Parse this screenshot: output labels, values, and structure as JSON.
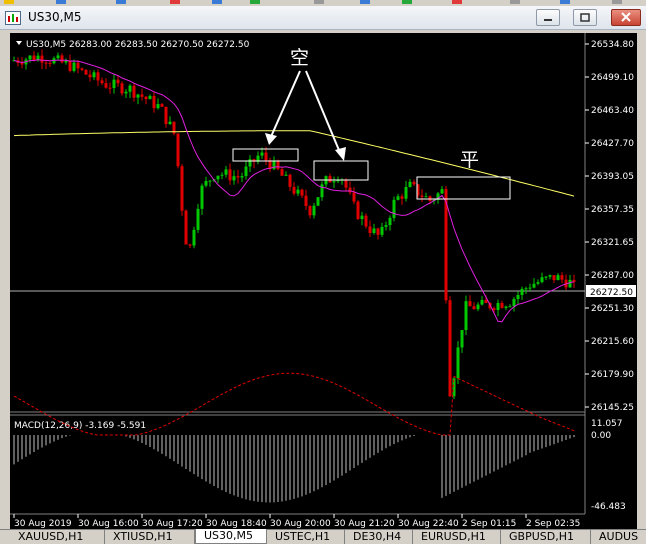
{
  "window": {
    "title": "US30,M5"
  },
  "chart": {
    "info_line": "US30,M5  26283.00 26283.50 26270.50 26272.50",
    "macd_label": "MACD(12,26,9) -3.169 -5.591",
    "price_levels": [
      "26534.80",
      "26499.10",
      "26463.40",
      "26427.70",
      "26393.05",
      "26357.35",
      "26321.65",
      "26287.00",
      "26251.30",
      "26215.60",
      "26179.90",
      "26145.25"
    ],
    "current_price": "26272.50",
    "macd_levels": [
      "11.057",
      "0.00",
      "-46.483"
    ],
    "time_labels": [
      "30 Aug 2019",
      "30 Aug 16:00",
      "30 Aug 17:20",
      "30 Aug 18:40",
      "30 Aug 20:00",
      "30 Aug 21:20",
      "30 Aug 22:40",
      "2 Sep 01:15",
      "2 Sep 02:35"
    ],
    "annotations": {
      "short_label": "空",
      "close_label": "平"
    },
    "colors": {
      "bull": "#00c800",
      "bear": "#e00000",
      "ma_slow": "#ffff66",
      "ma_fast": "#e020e0",
      "grid_text": "#ffffff"
    }
  },
  "chart_data": {
    "type": "candlestick",
    "symbol": "US30",
    "timeframe": "M5",
    "ylim": [
      26145.25,
      26534.8
    ],
    "open": 26283.0,
    "high": 26283.5,
    "low": 26270.5,
    "close": 26272.5,
    "macd": {
      "main": -3.169,
      "signal": -5.591,
      "ylim": [
        -46.483,
        11.057
      ]
    }
  },
  "tabs": [
    {
      "label": "XAUUSD,H1"
    },
    {
      "label": "XTIUSD,H1"
    },
    {
      "label": "US30,M5"
    },
    {
      "label": "USTEC,H1"
    },
    {
      "label": "DE30,H4"
    },
    {
      "label": "EURUSD,H1"
    },
    {
      "label": "GBPUSD,H1"
    },
    {
      "label": "AUDUS"
    }
  ]
}
